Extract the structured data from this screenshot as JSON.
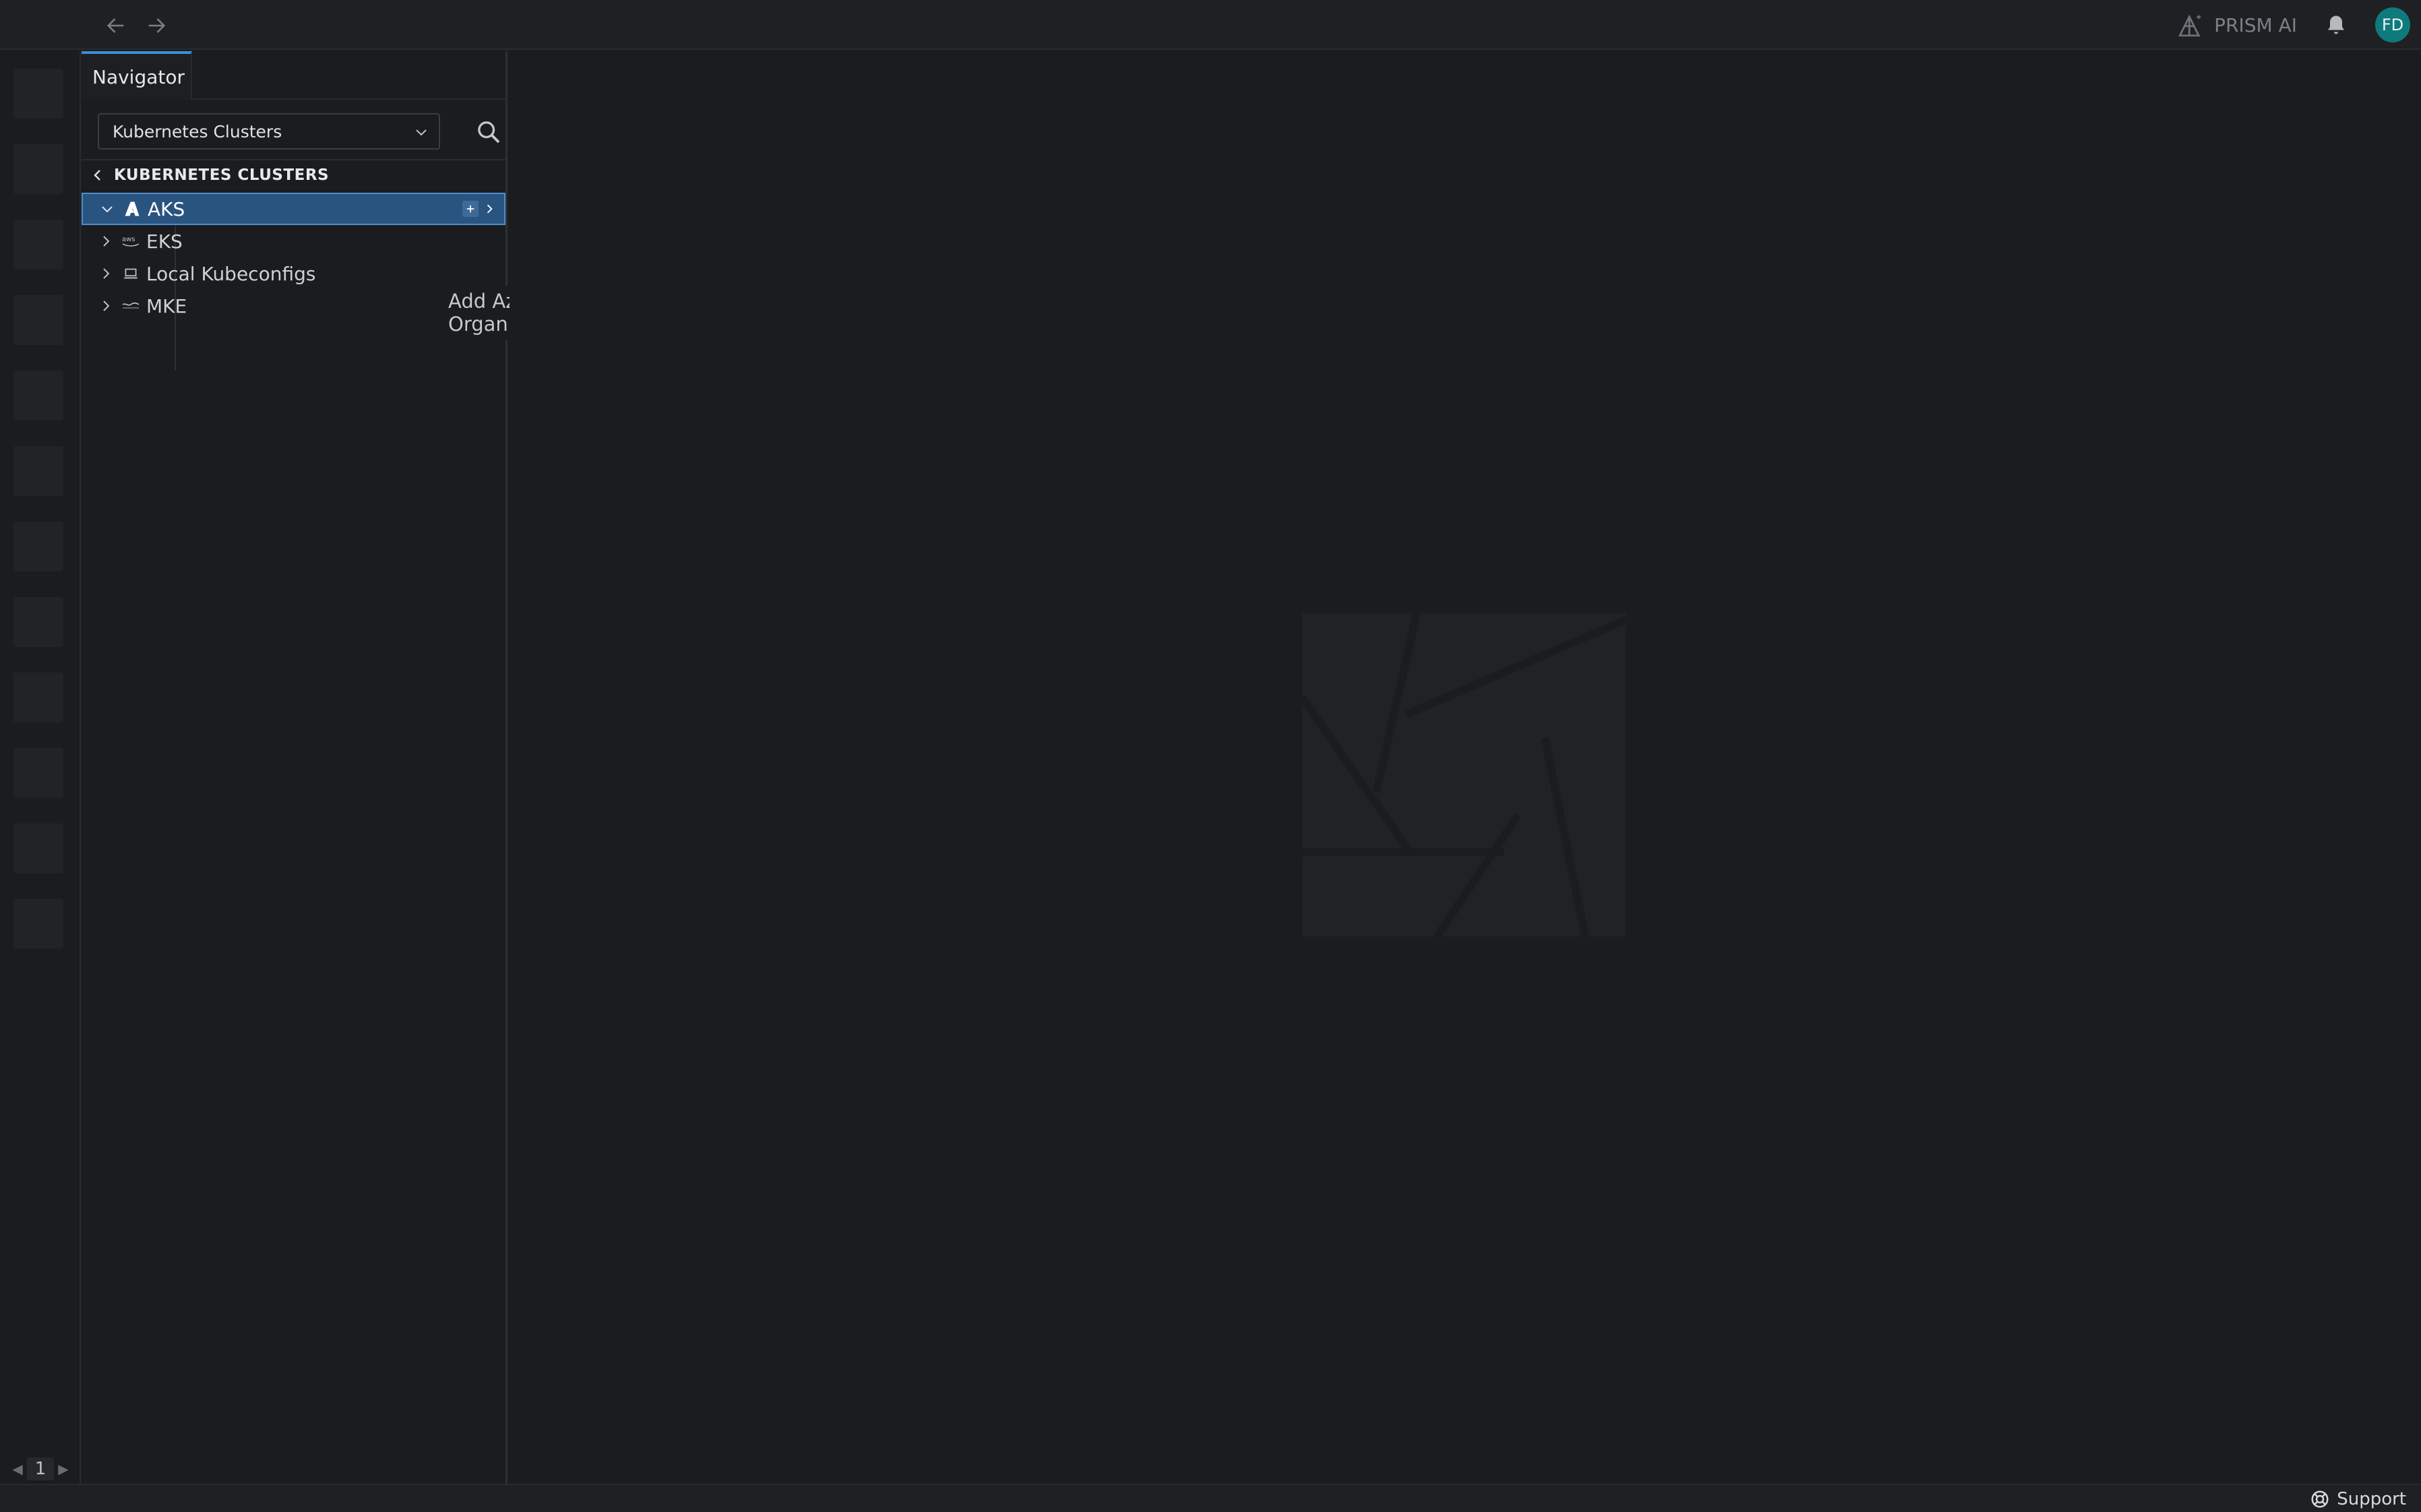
{
  "topbar": {
    "prism_label": "PRISM AI",
    "avatar_initials": "FD"
  },
  "activity_bar": {
    "page_number": "1"
  },
  "navigator": {
    "tab_label": "Navigator",
    "selector_value": "Kubernetes Clusters",
    "section_title": "KUBERNETES CLUSTERS",
    "items": [
      {
        "label": "AKS",
        "icon": "azure-icon",
        "expanded": true,
        "selected": true
      },
      {
        "label": "EKS",
        "icon": "aws-icon",
        "expanded": false,
        "selected": false
      },
      {
        "label": "Local Kubeconfigs",
        "icon": "laptop-icon",
        "expanded": false,
        "selected": false
      },
      {
        "label": "MKE",
        "icon": "mirantis-icon",
        "expanded": false,
        "selected": false
      }
    ]
  },
  "tooltip": {
    "text": "Add Azure Organization"
  },
  "statusbar": {
    "support_label": "Support"
  },
  "colors": {
    "background": "#1b1c1f",
    "accent": "#3b8fd8",
    "selected_row": "#2a5480",
    "avatar": "#0f7a7c"
  }
}
